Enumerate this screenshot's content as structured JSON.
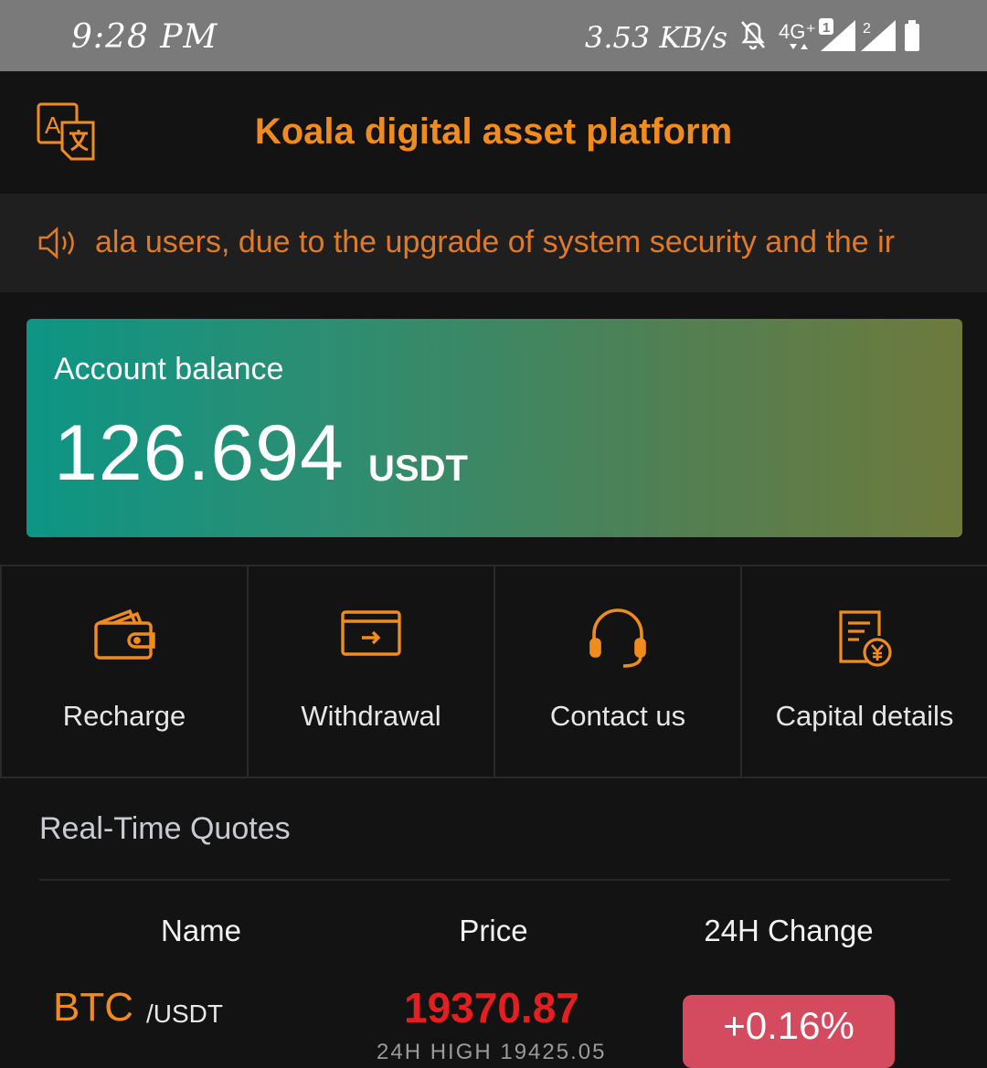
{
  "status_bar": {
    "time": "9:28 PM",
    "net_speed": "3.53 KB/s",
    "network_label": "4G⁺",
    "sim1": "1",
    "sim2": "2"
  },
  "header": {
    "title": "Koala digital asset platform",
    "language_icon": "translate-icon"
  },
  "notice": {
    "text": "ala users, due to the upgrade of system security and the ir",
    "icon": "speaker-icon"
  },
  "balance": {
    "label": "Account balance",
    "amount": "126.694",
    "unit": "USDT"
  },
  "actions": [
    {
      "label": "Recharge",
      "icon": "wallet-icon"
    },
    {
      "label": "Withdrawal",
      "icon": "withdraw-card-icon"
    },
    {
      "label": "Contact us",
      "icon": "headset-icon"
    },
    {
      "label": "Capital details",
      "icon": "bill-yen-icon"
    }
  ],
  "quotes": {
    "title": "Real-Time Quotes",
    "columns": [
      "Name",
      "Price",
      "24H Change"
    ],
    "rows": [
      {
        "name": "BTC",
        "pair": "/USDT",
        "price": "19370.87",
        "high": "24H HIGH 19425.05",
        "change": "+0.16%"
      }
    ]
  },
  "colors": {
    "accent": "#f08c1e",
    "background": "#131313",
    "price_up": "#e51f1f",
    "change_badge": "#d44a5e"
  }
}
